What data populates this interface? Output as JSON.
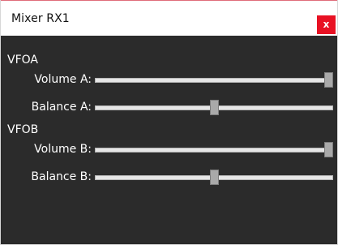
{
  "window": {
    "title": "Mixer RX1",
    "close_label": "x",
    "colors": {
      "background": "#2b2b2b",
      "titlebar": "#ffffff",
      "close": "#e81123"
    }
  },
  "groups": [
    {
      "label": "VFOA",
      "sliders": [
        {
          "label": "Volume A:",
          "value": 1.0
        },
        {
          "label": "Balance A:",
          "value": 0.5
        }
      ]
    },
    {
      "label": "VFOB",
      "sliders": [
        {
          "label": "Volume B:",
          "value": 1.0
        },
        {
          "label": "Balance B:",
          "value": 0.5
        }
      ]
    }
  ]
}
